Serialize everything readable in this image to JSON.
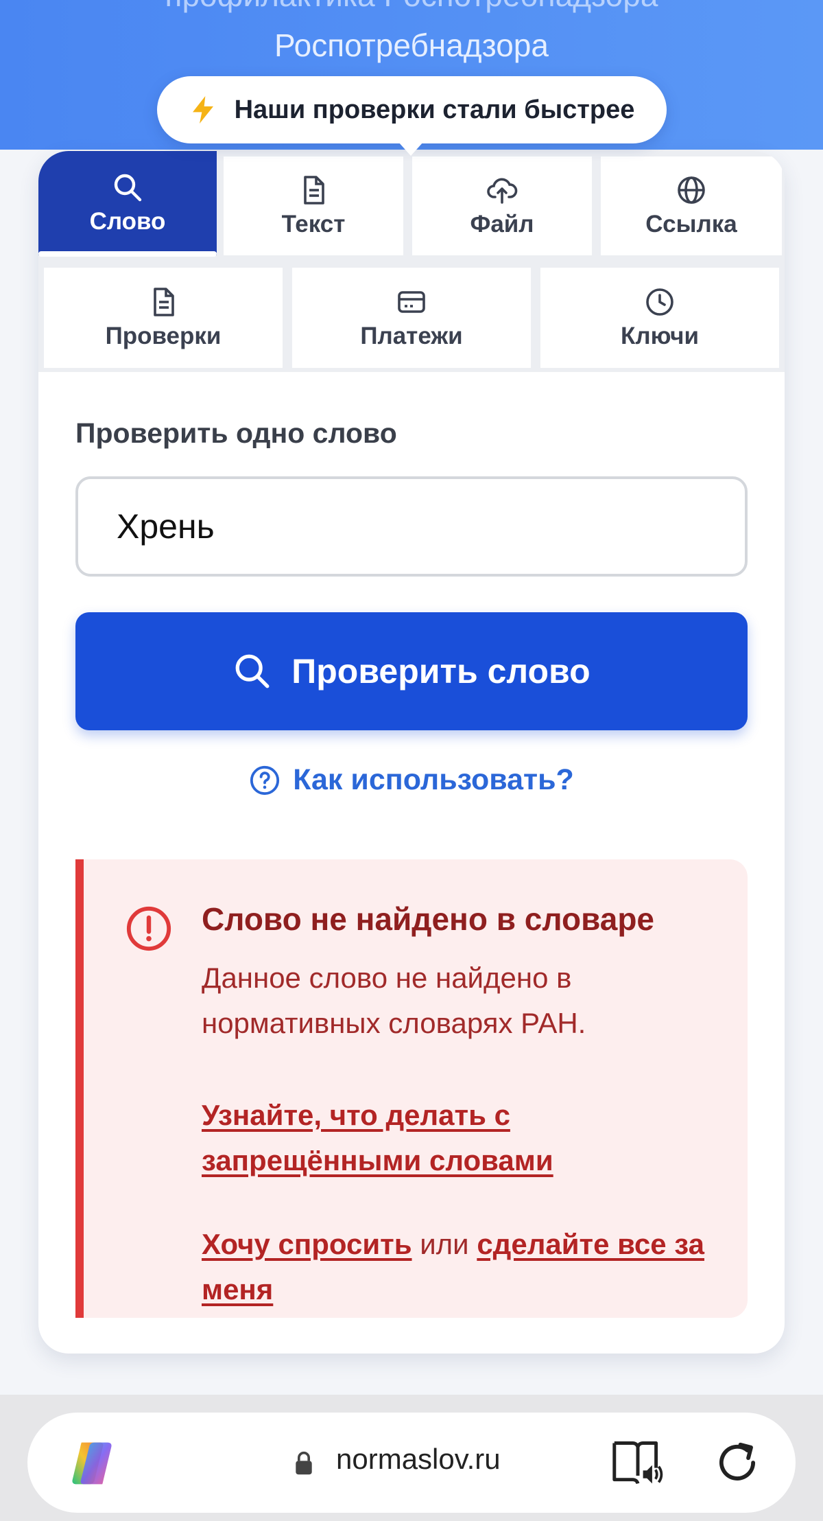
{
  "header": {
    "cut_text": "профилактика Роспотребнадзора",
    "title": "Роспотребнадзора",
    "toast": "Наши проверки стали быстрее"
  },
  "tabs": [
    {
      "label": "Слово",
      "icon": "search-icon",
      "active": true
    },
    {
      "label": "Текст",
      "icon": "document-icon"
    },
    {
      "label": "Файл",
      "icon": "cloud-upload-icon"
    },
    {
      "label": "Ссылка",
      "icon": "globe-icon"
    },
    {
      "label": "Проверки",
      "icon": "document-icon"
    },
    {
      "label": "Платежи",
      "icon": "card-icon"
    },
    {
      "label": "Ключи",
      "icon": "clock-icon"
    }
  ],
  "form": {
    "label": "Проверить одно слово",
    "value": "Хрень",
    "button": "Проверить слово",
    "help": "Как использовать?"
  },
  "alert": {
    "title": "Слово не найдено в словаре",
    "description": "Данное слово не найдено в нормативных словарях РАН.",
    "link": "Узнайте, что делать с запрещёнными словами",
    "ask": "Хочу спросить",
    "or": "или",
    "do_for_me": "сделайте все за меня"
  },
  "browser": {
    "url": "normaslov.ru"
  },
  "colors": {
    "accent": "#1a4fd9",
    "active_tab": "#1f3fae",
    "error": "#e03a3a",
    "error_bg": "#fdeeee"
  }
}
